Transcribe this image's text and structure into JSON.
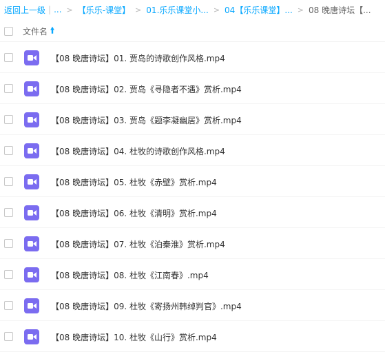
{
  "breadcrumb": {
    "back": "返回上一级",
    "bar": "|",
    "ellipsis": "...",
    "separator": ">",
    "items": [
      "【乐乐-课堂】",
      "01.乐乐课堂小...",
      "04【乐乐课堂】...",
      "08 晚唐诗坛【..."
    ]
  },
  "header": {
    "name_label": "文件名",
    "sort_icon": "arrow-up-icon"
  },
  "files": [
    {
      "name": "【08 晚唐诗坛】01. 贾岛的诗歌创作风格.mp4",
      "icon": "video-file-icon"
    },
    {
      "name": "【08 晚唐诗坛】02. 贾岛《寻隐者不遇》赏析.mp4",
      "icon": "video-file-icon"
    },
    {
      "name": "【08 晚唐诗坛】03. 贾岛《题李凝幽居》赏析.mp4",
      "icon": "video-file-icon"
    },
    {
      "name": "【08 晚唐诗坛】04. 杜牧的诗歌创作风格.mp4",
      "icon": "video-file-icon"
    },
    {
      "name": "【08 晚唐诗坛】05. 杜牧《赤壁》赏析.mp4",
      "icon": "video-file-icon"
    },
    {
      "name": "【08 晚唐诗坛】06. 杜牧《清明》赏析.mp4",
      "icon": "video-file-icon"
    },
    {
      "name": "【08 晚唐诗坛】07. 杜牧《泊秦淮》赏析.mp4",
      "icon": "video-file-icon"
    },
    {
      "name": "【08 晚唐诗坛】08. 杜牧《江南春》.mp4",
      "icon": "video-file-icon"
    },
    {
      "name": "【08 晚唐诗坛】09. 杜牧《寄扬州韩绰判官》.mp4",
      "icon": "video-file-icon"
    },
    {
      "name": "【08 晚唐诗坛】10. 杜牧《山行》赏析.mp4",
      "icon": "video-file-icon"
    }
  ],
  "colors": {
    "link": "#06a7ff",
    "video_icon": "#7b6cf0"
  }
}
